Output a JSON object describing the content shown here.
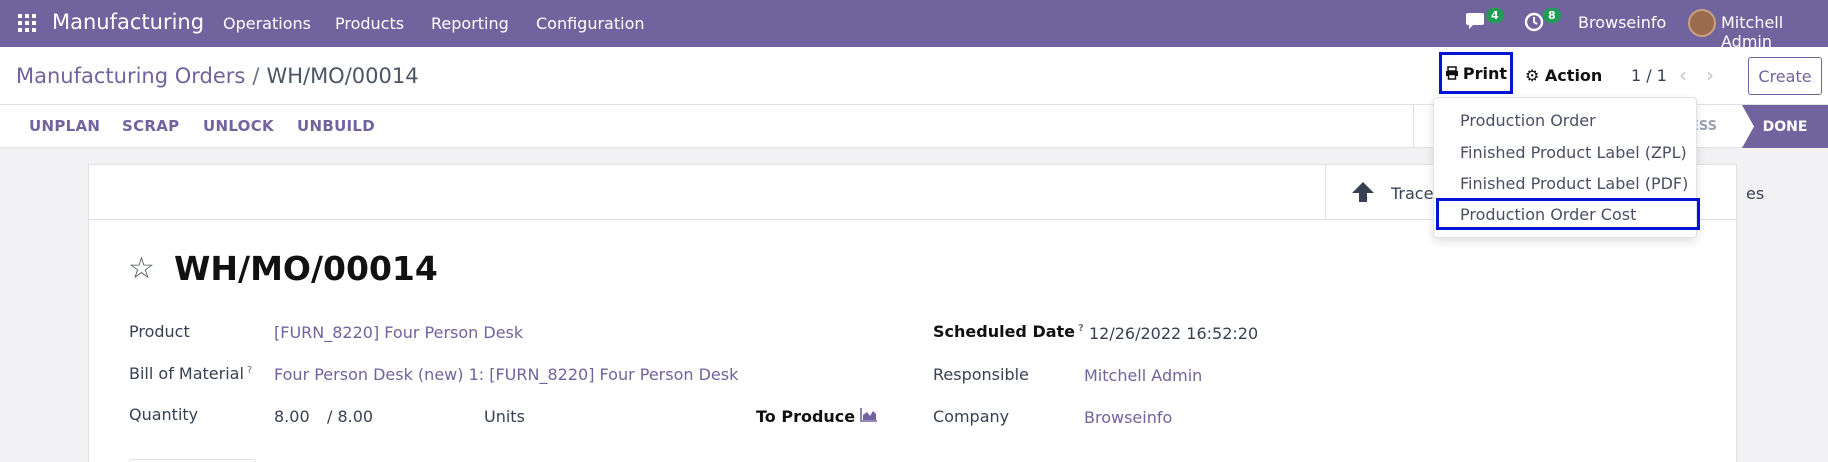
{
  "navbar": {
    "app_name": "Manufacturing",
    "menu": [
      "Operations",
      "Products",
      "Reporting",
      "Configuration"
    ],
    "messages_count": "4",
    "activities_count": "8",
    "company": "Browseinfo",
    "user": "Mitchell Admin",
    "icons": [
      "apps-grid-icon",
      "chat-icon",
      "clock-icon"
    ]
  },
  "breadcrumb": {
    "parent": "Manufacturing Orders",
    "separator": "/",
    "current": "WH/MO/00014"
  },
  "toolbar": {
    "print_label": "Print",
    "action_label": "Action",
    "pager": "1 / 1",
    "create_label": "Create"
  },
  "statusbar": {
    "buttons": [
      "UNPLAN",
      "SCRAP",
      "UNLOCK",
      "UNBUILD"
    ],
    "stage_partial": "RESS",
    "stage_active": "DONE"
  },
  "print_menu": {
    "items": [
      "Production Order",
      "Finished Product Label (ZPL)",
      "Finished Product Label (PDF)",
      "Production Order Cost"
    ],
    "highlighted_index": 3
  },
  "smart_buttons": {
    "traceability": "Trace",
    "trailing": "es"
  },
  "form": {
    "title": "WH/MO/00014",
    "product_label": "Product",
    "product_value": "[FURN_8220] Four Person Desk",
    "bom_label": "Bill of Material",
    "bom_help": "?",
    "bom_value": "Four Person Desk (new) 1: [FURN_8220] Four Person Desk",
    "quantity_label": "Quantity",
    "quantity_value": "8.00",
    "quantity_total": "/ 8.00",
    "uom": "Units",
    "to_produce_label": "To Produce",
    "scheduled_label": "Scheduled Date",
    "scheduled_help": "?",
    "scheduled_value": "12/26/2022 16:52:20",
    "responsible_label": "Responsible",
    "responsible_value": "Mitchell Admin",
    "company_label": "Company",
    "company_value": "Browseinfo"
  },
  "colors": {
    "brand": "#71639e",
    "highlight_border": "#0014d6",
    "badge": "#1f9d55"
  }
}
